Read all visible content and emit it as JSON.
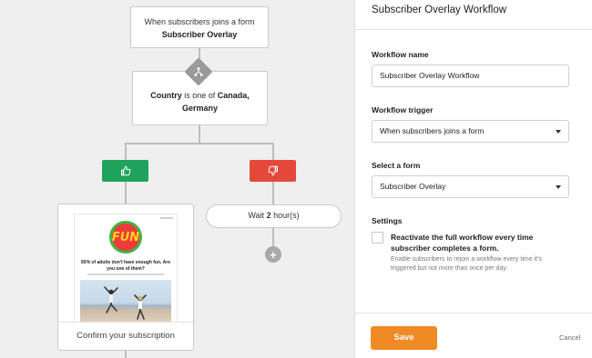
{
  "workflow": {
    "trigger_node": {
      "line1": "When subscribers joins a form",
      "line2": "Subscriber Overlay"
    },
    "condition_node": {
      "field": "Country",
      "operator": " is one of ",
      "values_line1": "Canada,",
      "values_line2": "Germany"
    },
    "email_node": {
      "caption": "Confirm your subscription",
      "logo_text": "FUN",
      "headline": "65% of adults don't have enough fun. Are you one of them?"
    },
    "wait_node": {
      "prefix": "Wait ",
      "amount": "2",
      "unit": " hour(s)"
    },
    "colors": {
      "yes": "#1fa35c",
      "no": "#e5483a",
      "accent": "#f08a24"
    }
  },
  "panel": {
    "title": "Subscriber Overlay Workflow",
    "name_label": "Workflow name",
    "name_value": "Subscriber Overlay Workflow",
    "trigger_label": "Workflow trigger",
    "trigger_value": "When subscribers joins a form",
    "form_label": "Select a form",
    "form_value": "Subscriber Overlay",
    "settings_label": "Settings",
    "reactivate_title": "Reactivate the full workflow every time subscriber completes a form.",
    "reactivate_desc": "Enable subscribers to rejoin a workflow every time it's triggered but not more than once per day.",
    "reactivate_checked": false,
    "save_label": "Save",
    "cancel_label": "Cancel"
  }
}
